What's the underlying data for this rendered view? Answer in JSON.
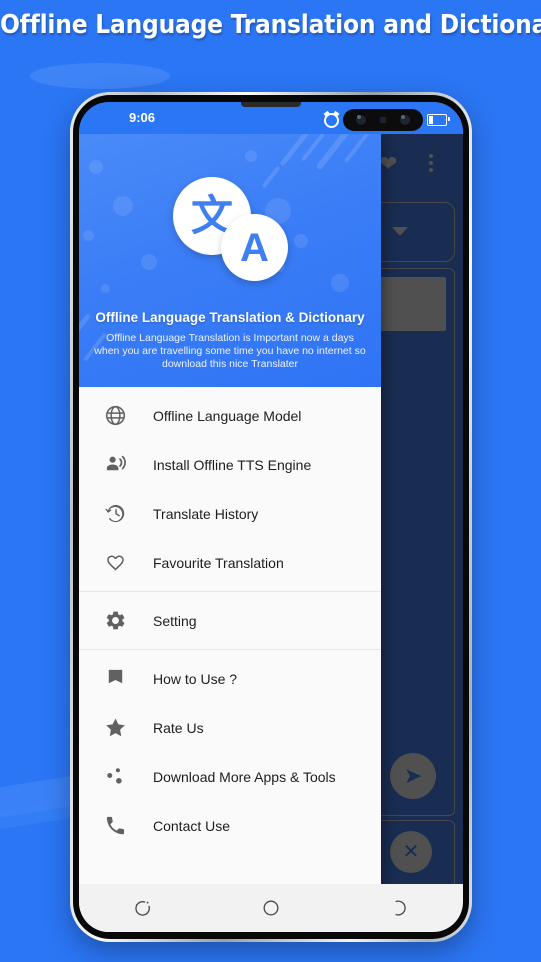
{
  "promo": {
    "title": "Offline Language Translation and Dictionary",
    "background_color": "#2b76f5"
  },
  "phone": {
    "status_bar": {
      "time": "9:06",
      "alarm_icon": "alarm-clock-icon",
      "battery_icon": "battery-icon"
    },
    "navigation_bar": {
      "recents_label": "recents-icon",
      "home_label": "home-icon",
      "back_label": "back-icon"
    }
  },
  "drawer": {
    "header": {
      "logo_primary_glyph": "文",
      "logo_secondary_glyph": "A",
      "title": "Offline Language Translation & Dictionary",
      "description": "Offline Language Translation is Important now a days when you are travelling some time you have no internet so download this  nice Translater",
      "accent_color": "#3b7df6"
    },
    "groups": [
      {
        "items": [
          {
            "label": "Offline Language Model",
            "icon": "globe-icon"
          },
          {
            "label": "Install Offline TTS Engine",
            "icon": "record-voice-over-icon"
          },
          {
            "label": "Translate History",
            "icon": "history-icon"
          },
          {
            "label": "Favourite Translation",
            "icon": "heart-outline-icon"
          }
        ]
      },
      {
        "items": [
          {
            "label": "Setting",
            "icon": "gear-icon"
          }
        ]
      },
      {
        "items": [
          {
            "label": "How to Use ?",
            "icon": "book-icon"
          },
          {
            "label": "Rate Us",
            "icon": "star-icon"
          },
          {
            "label": "Download More Apps & Tools",
            "icon": "apps-dots-icon"
          },
          {
            "label": "Contact Use",
            "icon": "phone-icon"
          }
        ]
      }
    ]
  },
  "background_app": {
    "surface_color": "#2c4c8c",
    "control_color": "#8a8a8a",
    "favorite_icon": "heart-icon",
    "overflow_icon": "more-vertical-icon",
    "confirm_icon": "check-circle-icon",
    "dropdown_icon": "chevron-down-icon",
    "send_icon": "send-icon",
    "clear_icon": "close-circle-icon"
  }
}
